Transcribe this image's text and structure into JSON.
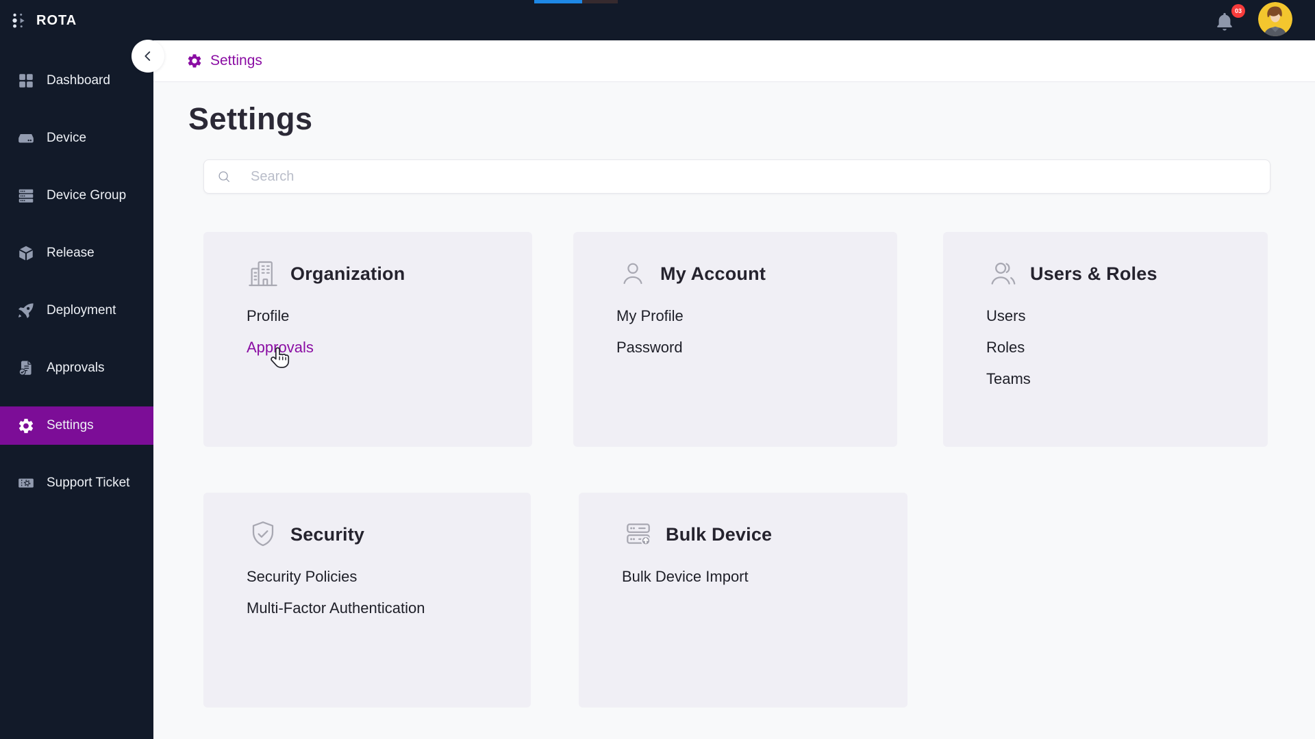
{
  "app": {
    "name": "ROTA"
  },
  "topbar": {
    "notification_count": "03"
  },
  "sidebar": {
    "items": [
      {
        "label": "Dashboard",
        "icon": "dashboard-icon",
        "active": false
      },
      {
        "label": "Device",
        "icon": "device-icon",
        "active": false
      },
      {
        "label": "Device Group",
        "icon": "device-group-icon",
        "active": false
      },
      {
        "label": "Release",
        "icon": "release-icon",
        "active": false
      },
      {
        "label": "Deployment",
        "icon": "deployment-icon",
        "active": false
      },
      {
        "label": "Approvals",
        "icon": "approvals-icon",
        "active": false
      },
      {
        "label": "Settings",
        "icon": "settings-icon",
        "active": true
      },
      {
        "label": "Support Ticket",
        "icon": "support-ticket-icon",
        "active": false
      }
    ]
  },
  "breadcrumb": {
    "label": "Settings"
  },
  "page": {
    "title": "Settings"
  },
  "search": {
    "placeholder": "Search"
  },
  "cards": [
    {
      "title": "Organization",
      "icon": "building-icon",
      "links": [
        {
          "label": "Profile"
        },
        {
          "label": "Approvals",
          "hovered": true
        }
      ]
    },
    {
      "title": "My Account",
      "icon": "user-icon",
      "links": [
        {
          "label": "My Profile"
        },
        {
          "label": "Password"
        }
      ]
    },
    {
      "title": "Users & Roles",
      "icon": "users-icon",
      "links": [
        {
          "label": "Users"
        },
        {
          "label": "Roles"
        },
        {
          "label": "Teams"
        }
      ]
    },
    {
      "title": "Security",
      "icon": "shield-check-icon",
      "links": [
        {
          "label": "Security Policies"
        },
        {
          "label": "Multi-Factor Authentication"
        }
      ]
    },
    {
      "title": "Bulk Device",
      "icon": "server-upload-icon",
      "links": [
        {
          "label": "Bulk Device Import"
        }
      ]
    }
  ],
  "colors": {
    "accent": "#8a0da3",
    "sidebar_active_bg": "#7c0d97",
    "topbar_bg": "#121a29",
    "notification_badge": "#f73b3b",
    "loading_bar": "#1e88e5"
  }
}
